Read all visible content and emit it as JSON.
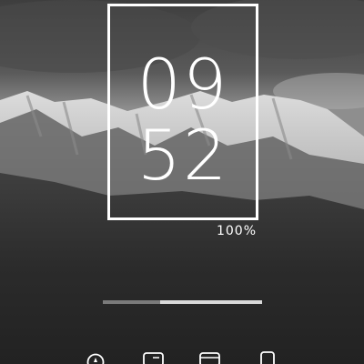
{
  "clock": {
    "hours": "09",
    "minutes": "52"
  },
  "battery": {
    "label": "100%"
  },
  "progress": {
    "fraction": 0.36
  },
  "dock": {
    "icons": [
      "compass-icon",
      "message-square-icon",
      "browser-window-icon",
      "phone-icon"
    ]
  },
  "colors": {
    "text": "#ffffff",
    "track": "#d9d9d9",
    "track_fill": "#7a7a7a"
  }
}
